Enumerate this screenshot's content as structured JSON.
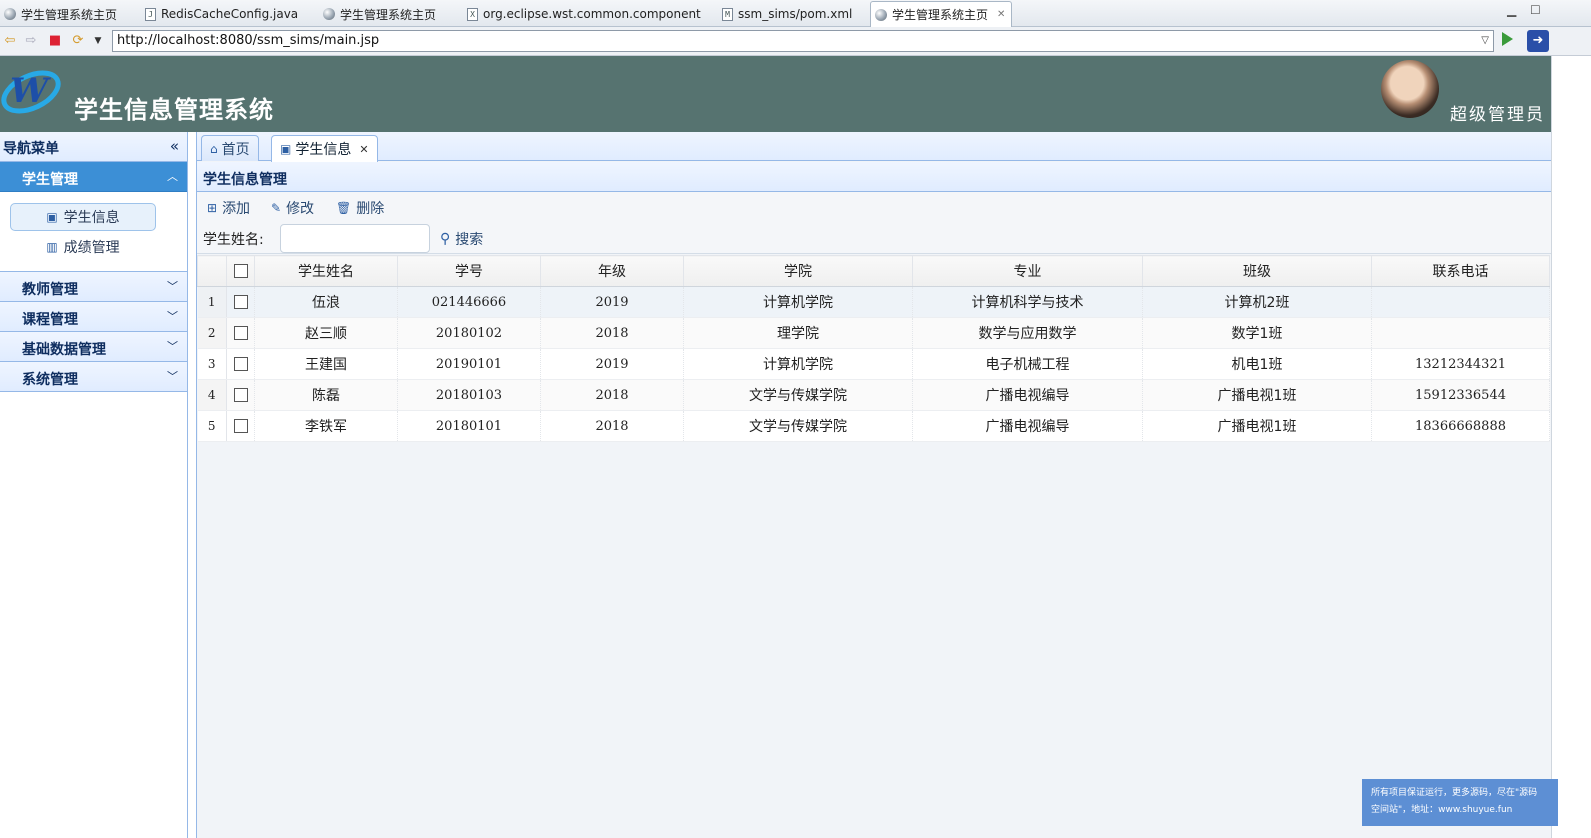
{
  "eclipse_tabs": [
    {
      "label": "学生管理系统主页",
      "icon": "globe-icon"
    },
    {
      "label": "RedisCacheConfig.java",
      "icon": "java-file-icon"
    },
    {
      "label": "学生管理系统主页",
      "icon": "globe-icon"
    },
    {
      "label": "org.eclipse.wst.common.component",
      "icon": "xml-file-icon"
    },
    {
      "label": "ssm_sims/pom.xml",
      "icon": "maven-file-icon"
    },
    {
      "label": "学生管理系统主页",
      "icon": "globe-icon",
      "active": true
    }
  ],
  "browser": {
    "url": "http://localhost:8080/ssm_sims/main.jsp"
  },
  "app": {
    "title": "学生信息管理系统",
    "user_role": "超级管理员",
    "header_color": "#567370"
  },
  "sidebar": {
    "title": "导航菜单",
    "groups": [
      {
        "label": "学生管理",
        "expanded": true,
        "items": [
          {
            "label": "学生信息",
            "icon": "user-card-icon",
            "selected": true
          },
          {
            "label": "成绩管理",
            "icon": "bar-chart-icon"
          }
        ]
      },
      {
        "label": "教师管理"
      },
      {
        "label": "课程管理"
      },
      {
        "label": "基础数据管理"
      },
      {
        "label": "系统管理"
      }
    ]
  },
  "tabs": [
    {
      "label": "首页",
      "icon": "home-icon"
    },
    {
      "label": "学生信息",
      "icon": "user-card-icon",
      "active": true
    }
  ],
  "panel": {
    "title": "学生信息管理",
    "toolbar": {
      "add": "添加",
      "edit": "修改",
      "delete": "删除"
    },
    "search": {
      "label": "学生姓名:",
      "value": "",
      "button": "搜索"
    }
  },
  "table": {
    "columns": [
      "学生姓名",
      "学号",
      "年级",
      "学院",
      "专业",
      "班级",
      "联系电话"
    ],
    "rows": [
      {
        "n": "1",
        "name": "伍浪",
        "id": "021446666",
        "grade": "2019",
        "college": "计算机学院",
        "major": "计算机科学与技术",
        "class": "计算机2班",
        "phone": ""
      },
      {
        "n": "2",
        "name": "赵三顺",
        "id": "20180102",
        "grade": "2018",
        "college": "理学院",
        "major": "数学与应用数学",
        "class": "数学1班",
        "phone": ""
      },
      {
        "n": "3",
        "name": "王建国",
        "id": "20190101",
        "grade": "2019",
        "college": "计算机学院",
        "major": "电子机械工程",
        "class": "机电1班",
        "phone": "13212344321"
      },
      {
        "n": "4",
        "name": "陈磊",
        "id": "20180103",
        "grade": "2018",
        "college": "文学与传媒学院",
        "major": "广播电视编导",
        "class": "广播电视1班",
        "phone": "15912336544"
      },
      {
        "n": "5",
        "name": "李铁军",
        "id": "20180101",
        "grade": "2018",
        "college": "文学与传媒学院",
        "major": "广播电视编导",
        "class": "广播电视1班",
        "phone": "18366668888"
      }
    ]
  },
  "notice": {
    "line1": "所有项目保证运行，更多源码，尽在\"源码",
    "line2": "空间站\"，地址：www.shuyue.fun"
  }
}
